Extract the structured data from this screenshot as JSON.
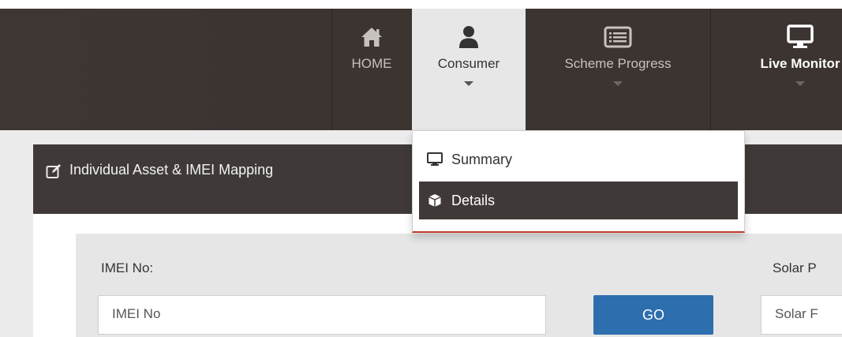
{
  "navbar": {
    "items": [
      {
        "label": "HOME",
        "icon": "home-icon"
      },
      {
        "label": "Consumer",
        "icon": "user-icon"
      },
      {
        "label": "Scheme Progress",
        "icon": "list-icon"
      },
      {
        "label": "Live Monitor",
        "icon": "monitor-icon"
      }
    ],
    "active_index": 1
  },
  "dropdown": {
    "items": [
      {
        "label": "Summary",
        "icon": "desktop-icon"
      },
      {
        "label": "Details",
        "icon": "cube-icon"
      }
    ],
    "selected_index": 1
  },
  "panel": {
    "title": "Individual Asset & IMEI Mapping",
    "imei_label": "IMEI No:",
    "imei_placeholder": "IMEI No",
    "go_label": "GO",
    "solar_label": "Solar P",
    "solar_placeholder": "Solar F"
  },
  "colors": {
    "navbar_bg": "#3b3431",
    "active_tab_bg": "#e7e7e7",
    "panel_header_bg": "#3f3a38",
    "go_button": "#2d6fae",
    "dropdown_accent": "#c0392b"
  }
}
